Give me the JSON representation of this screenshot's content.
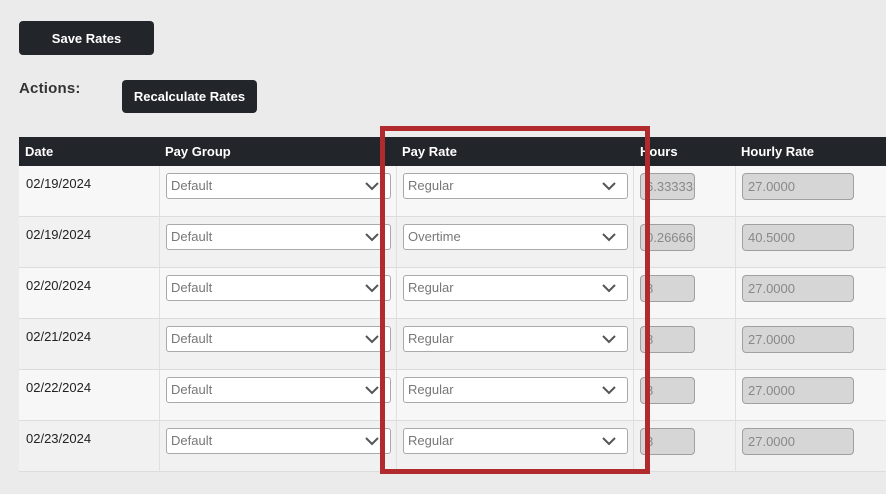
{
  "toolbar": {
    "save_label": "Save Rates"
  },
  "actions": {
    "label": "Actions:",
    "recalculate_label": "Recalculate Rates"
  },
  "table": {
    "headers": {
      "date": "Date",
      "pay_group": "Pay Group",
      "pay_rate": "Pay Rate",
      "hours": "Hours",
      "hourly_rate": "Hourly Rate"
    },
    "rows": [
      {
        "date": "02/19/2024",
        "pay_group": "Default",
        "pay_rate": "Regular",
        "hours": "6.3333333",
        "hourly_rate": "27.0000"
      },
      {
        "date": "02/19/2024",
        "pay_group": "Default",
        "pay_rate": "Overtime",
        "hours": "0.2666666",
        "hourly_rate": "40.5000"
      },
      {
        "date": "02/20/2024",
        "pay_group": "Default",
        "pay_rate": "Regular",
        "hours": "8",
        "hourly_rate": "27.0000"
      },
      {
        "date": "02/21/2024",
        "pay_group": "Default",
        "pay_rate": "Regular",
        "hours": "8",
        "hourly_rate": "27.0000"
      },
      {
        "date": "02/22/2024",
        "pay_group": "Default",
        "pay_rate": "Regular",
        "hours": "8",
        "hourly_rate": "27.0000"
      },
      {
        "date": "02/23/2024",
        "pay_group": "Default",
        "pay_rate": "Regular",
        "hours": "8",
        "hourly_rate": "27.0000"
      }
    ]
  },
  "colors": {
    "header_bg": "#222529",
    "highlight": "#b02a2e",
    "readonly_bg": "#d6d6d6"
  },
  "icons": {
    "dropdown": "chevron-down-icon"
  }
}
